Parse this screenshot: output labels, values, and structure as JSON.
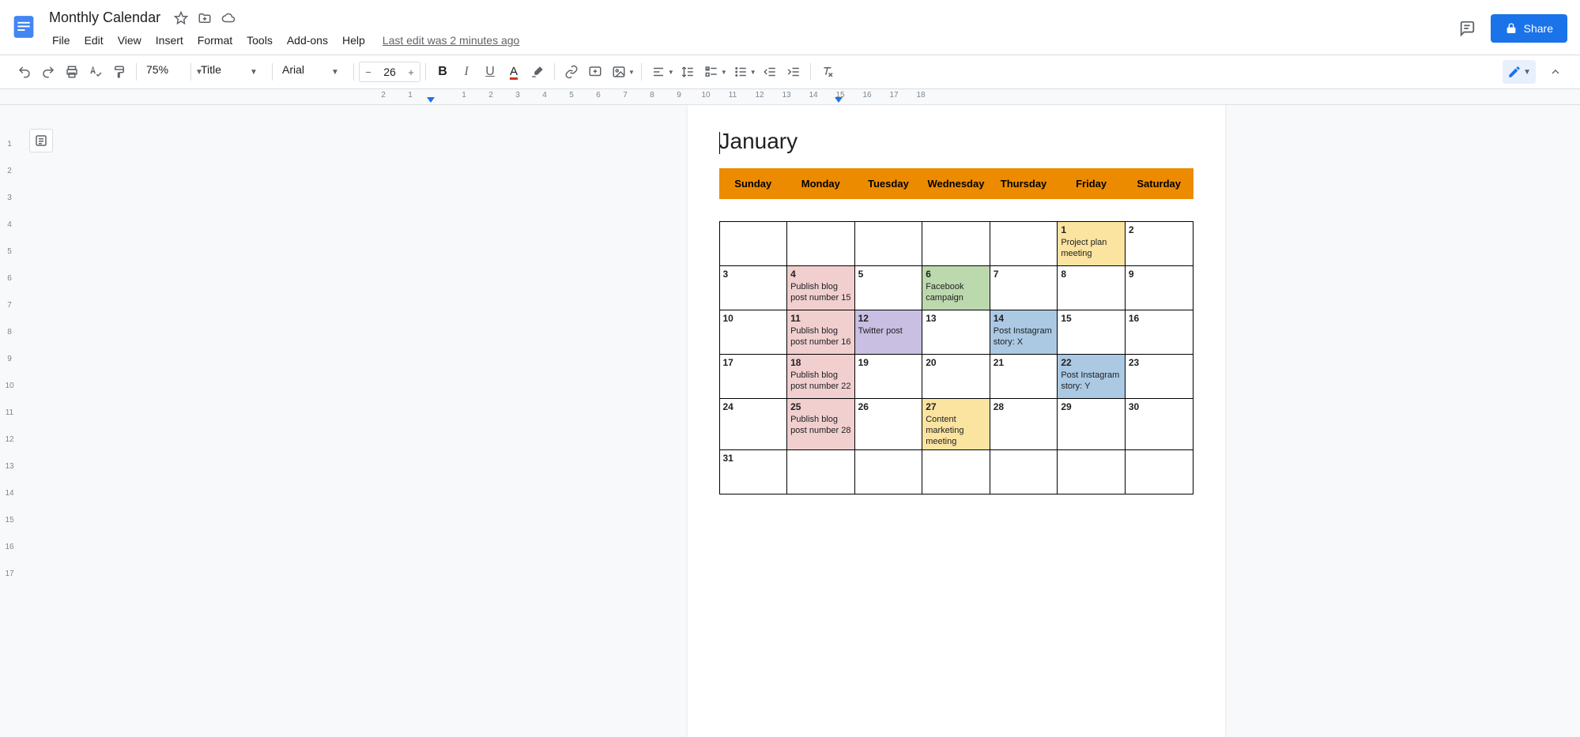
{
  "doc": {
    "title": "Monthly Calendar"
  },
  "menu": {
    "file": "File",
    "edit": "Edit",
    "view": "View",
    "insert": "Insert",
    "format": "Format",
    "tools": "Tools",
    "addons": "Add-ons",
    "help": "Help",
    "last_edit": "Last edit was 2 minutes ago"
  },
  "share": {
    "label": "Share"
  },
  "toolbar": {
    "zoom": "75%",
    "style": "Title",
    "font": "Arial",
    "fontsize": "26"
  },
  "ruler": {
    "ticks": [
      "2",
      "1",
      "",
      "1",
      "2",
      "3",
      "4",
      "5",
      "6",
      "7",
      "8",
      "9",
      "10",
      "11",
      "12",
      "13",
      "14",
      "15",
      "16",
      "17",
      "18"
    ]
  },
  "vruler": [
    "",
    "1",
    "2",
    "3",
    "4",
    "5",
    "6",
    "7",
    "8",
    "9",
    "10",
    "11",
    "12",
    "13",
    "14",
    "15",
    "16",
    "17"
  ],
  "content": {
    "month": "January",
    "days": [
      "Sunday",
      "Monday",
      "Tuesday",
      "Wednesday",
      "Thursday",
      "Friday",
      "Saturday"
    ],
    "weeks": [
      [
        {
          "num": "",
          "text": "",
          "color": ""
        },
        {
          "num": "",
          "text": "",
          "color": ""
        },
        {
          "num": "",
          "text": "",
          "color": ""
        },
        {
          "num": "",
          "text": "",
          "color": ""
        },
        {
          "num": "",
          "text": "",
          "color": ""
        },
        {
          "num": "1",
          "text": "Project plan meeting",
          "color": "c-yellow"
        },
        {
          "num": "2",
          "text": "",
          "color": ""
        }
      ],
      [
        {
          "num": "3",
          "text": "",
          "color": ""
        },
        {
          "num": "4",
          "text": "Publish blog post number 15",
          "color": "c-pink"
        },
        {
          "num": "5",
          "text": "",
          "color": ""
        },
        {
          "num": "6",
          "text": "Facebook campaign",
          "color": "c-green"
        },
        {
          "num": "7",
          "text": "",
          "color": ""
        },
        {
          "num": "8",
          "text": "",
          "color": ""
        },
        {
          "num": "9",
          "text": "",
          "color": ""
        }
      ],
      [
        {
          "num": "10",
          "text": "",
          "color": ""
        },
        {
          "num": "11",
          "text": "Publish blog post number 16",
          "color": "c-pink"
        },
        {
          "num": "12",
          "text": "Twitter post",
          "color": "c-purple"
        },
        {
          "num": "13",
          "text": "",
          "color": ""
        },
        {
          "num": "14",
          "text": "Post Instagram story: X",
          "color": "c-blue"
        },
        {
          "num": "15",
          "text": "",
          "color": ""
        },
        {
          "num": "16",
          "text": "",
          "color": ""
        }
      ],
      [
        {
          "num": "17",
          "text": "",
          "color": ""
        },
        {
          "num": "18",
          "text": "Publish blog post number 22",
          "color": "c-pink"
        },
        {
          "num": "19",
          "text": "",
          "color": ""
        },
        {
          "num": "20",
          "text": "",
          "color": ""
        },
        {
          "num": "21",
          "text": "",
          "color": ""
        },
        {
          "num": "22",
          "text": "Post Instagram story: Y",
          "color": "c-blue"
        },
        {
          "num": "23",
          "text": "",
          "color": ""
        }
      ],
      [
        {
          "num": "24",
          "text": "",
          "color": ""
        },
        {
          "num": "25",
          "text": "Publish blog post number 28",
          "color": "c-pink"
        },
        {
          "num": "26",
          "text": "",
          "color": ""
        },
        {
          "num": "27",
          "text": "Content marketing meeting",
          "color": "c-yellow"
        },
        {
          "num": "28",
          "text": "",
          "color": ""
        },
        {
          "num": "29",
          "text": "",
          "color": ""
        },
        {
          "num": "30",
          "text": "",
          "color": ""
        }
      ],
      [
        {
          "num": "31",
          "text": "",
          "color": ""
        },
        {
          "num": "",
          "text": "",
          "color": ""
        },
        {
          "num": "",
          "text": "",
          "color": ""
        },
        {
          "num": "",
          "text": "",
          "color": ""
        },
        {
          "num": "",
          "text": "",
          "color": ""
        },
        {
          "num": "",
          "text": "",
          "color": ""
        },
        {
          "num": "",
          "text": "",
          "color": ""
        }
      ]
    ]
  }
}
